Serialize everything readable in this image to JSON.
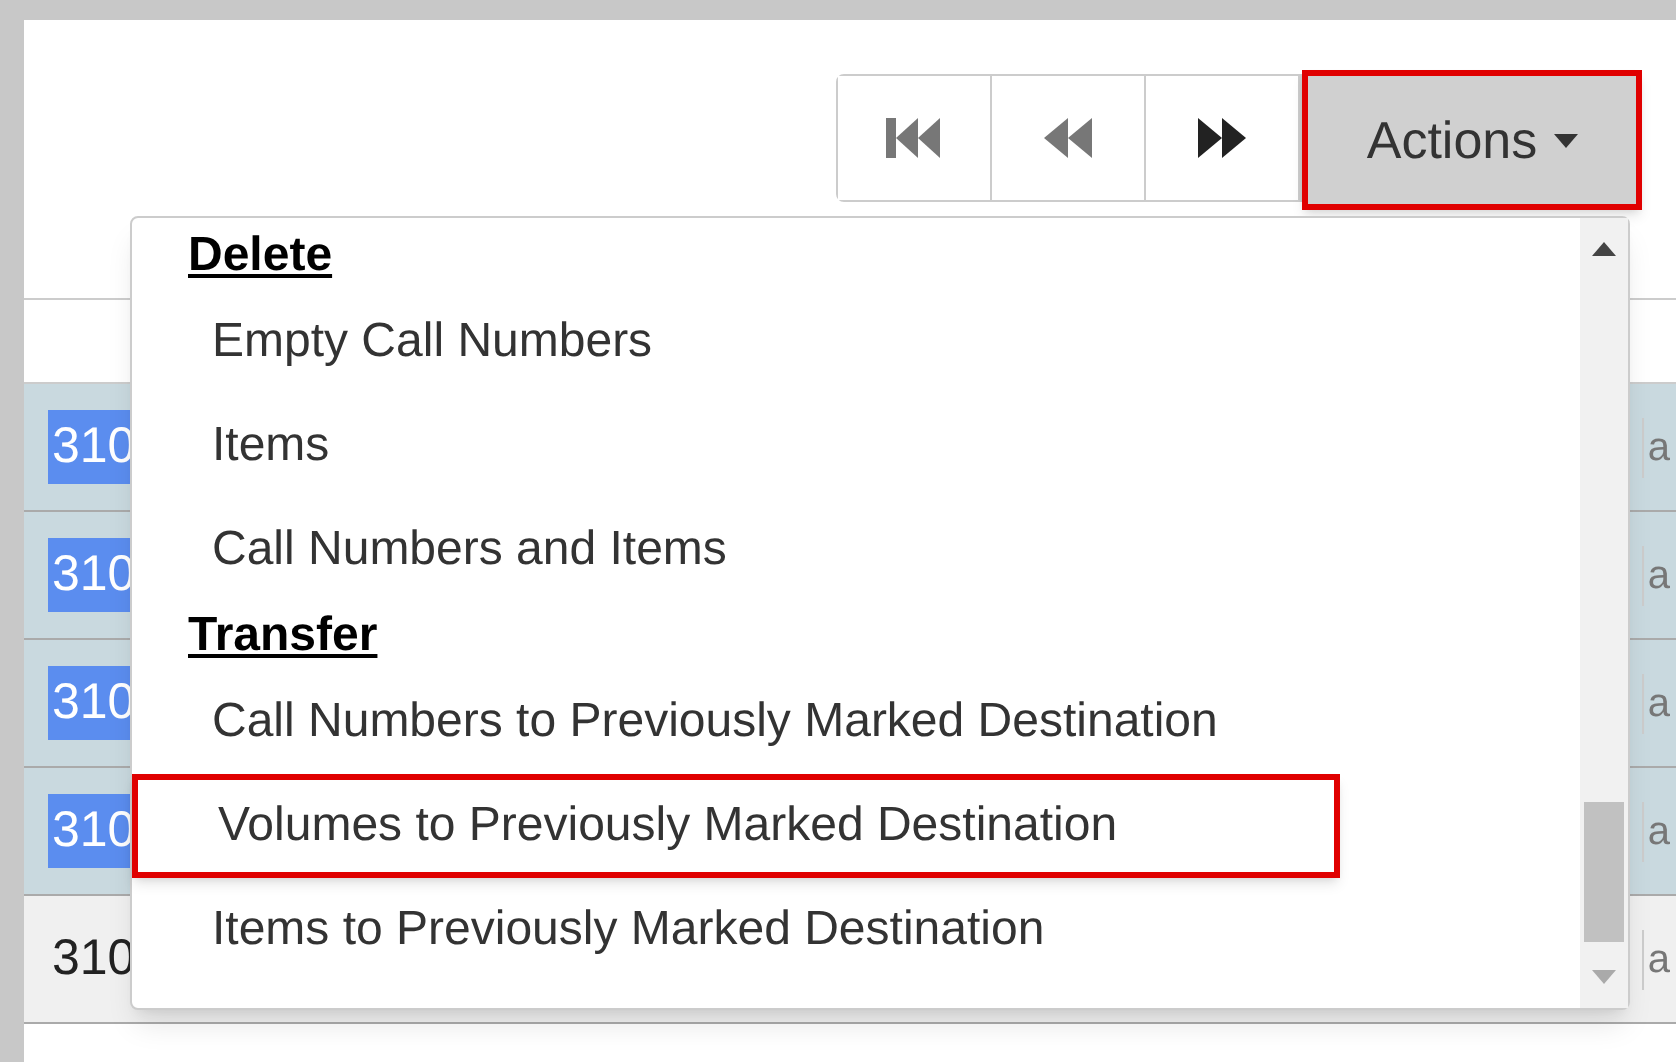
{
  "toolbar": {
    "nav_buttons": [
      {
        "kind": "first"
      },
      {
        "kind": "previous"
      },
      {
        "kind": "next"
      }
    ],
    "actions_button": {
      "label": "Actions",
      "highlighted": true
    }
  },
  "table": {
    "rows": [
      {
        "column_1": "310",
        "column_2": "a",
        "selected": true
      },
      {
        "column_1": "310",
        "column_2": "a",
        "selected": true
      },
      {
        "column_1": "310",
        "column_2": "a",
        "selected": true
      },
      {
        "column_1": "310",
        "column_2": "a",
        "selected": true
      },
      {
        "column_1": "310",
        "column_2": "a",
        "selected": false
      }
    ]
  },
  "menu": {
    "sections": [
      {
        "header": "Delete",
        "items": [
          {
            "label": "Empty Call Numbers",
            "highlighted": false
          },
          {
            "label": "Items",
            "highlighted": false
          },
          {
            "label": "Call Numbers and Items",
            "highlighted": false
          }
        ]
      },
      {
        "header": "Transfer",
        "items": [
          {
            "label": "Call Numbers to Previously Marked Destination",
            "highlighted": false
          },
          {
            "label": "Volumes to Previously Marked Destination",
            "highlighted": true
          },
          {
            "label": "Items to Previously Marked Destination",
            "highlighted": false
          }
        ]
      }
    ]
  }
}
